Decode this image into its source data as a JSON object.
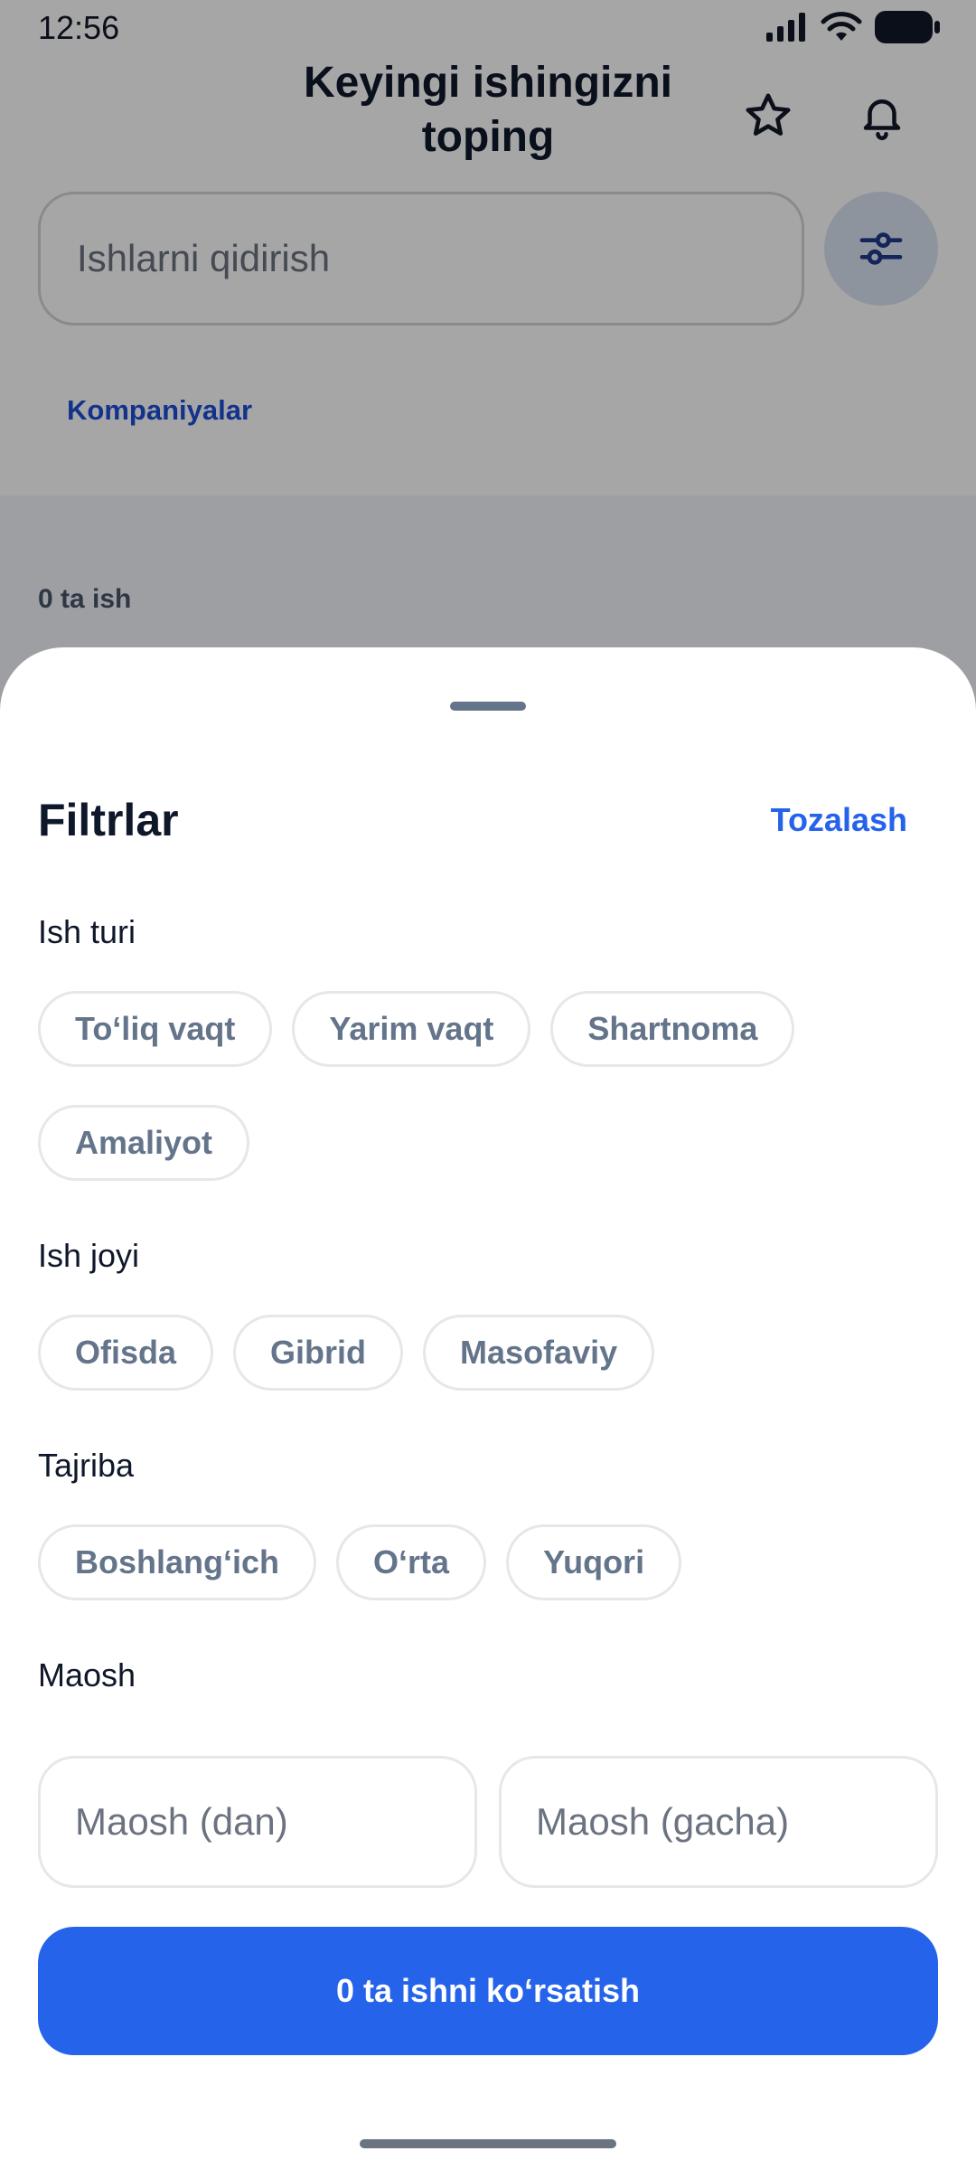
{
  "status_bar": {
    "time": "12:56"
  },
  "header": {
    "title": "Keyingi ishingizni toping",
    "favorites_icon": "star-icon",
    "notifications_icon": "bell-icon"
  },
  "search": {
    "placeholder": "Ishlarni qidirish",
    "value": ""
  },
  "tabs": {
    "companies": "Kompaniyalar"
  },
  "results": {
    "count_label": "0 ta ish"
  },
  "filters": {
    "title": "Filtrlar",
    "clear_label": "Tozalash",
    "job_type": {
      "label": "Ish turi",
      "options": [
        "To‘liq vaqt",
        "Yarim vaqt",
        "Shartnoma",
        "Amaliyot"
      ]
    },
    "location": {
      "label": "Ish joyi",
      "options": [
        "Ofisda",
        "Gibrid",
        "Masofaviy"
      ]
    },
    "experience": {
      "label": "Tajriba",
      "options": [
        "Boshlang‘ich",
        "O‘rta",
        "Yuqori"
      ]
    },
    "salary": {
      "label": "Maosh",
      "from_placeholder": "Maosh (dan)",
      "to_placeholder": "Maosh (gacha)"
    },
    "apply_label": "0 ta ishni ko‘rsatish"
  },
  "colors": {
    "accent": "#2563eb",
    "link": "#1d4ed8",
    "chip_text": "#64748b",
    "title_text": "#0f172a"
  }
}
